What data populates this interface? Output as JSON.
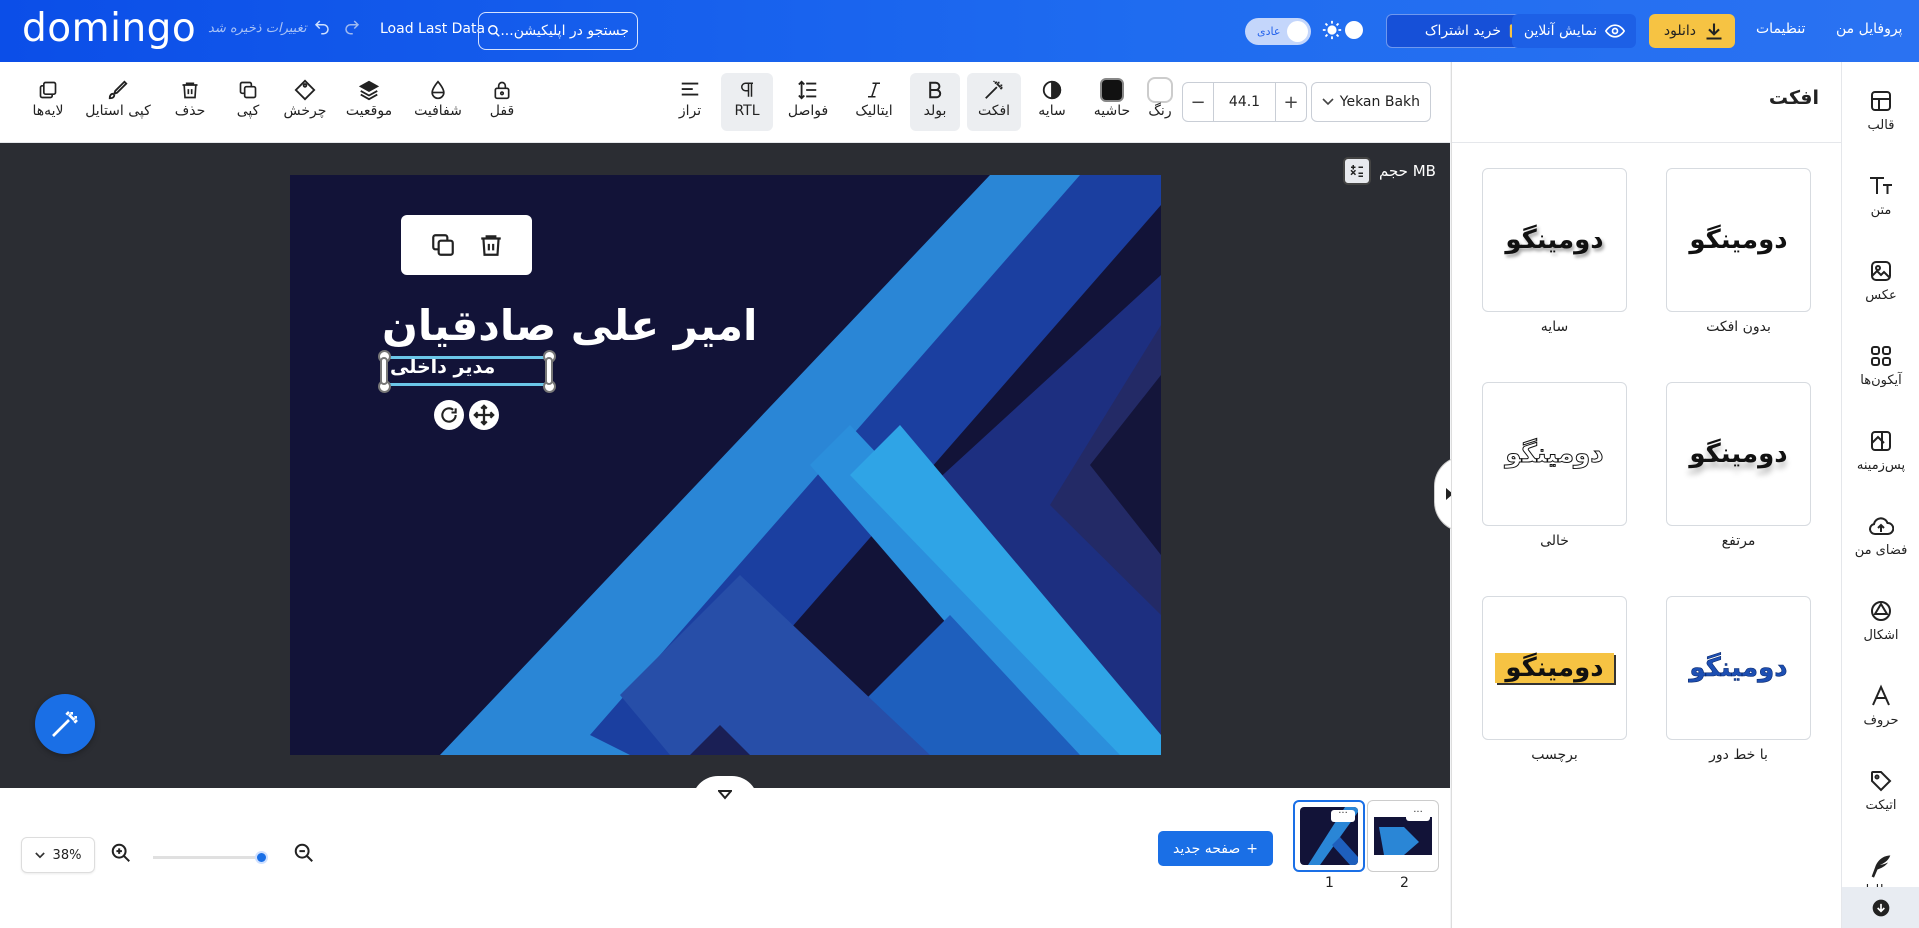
{
  "topbar": {
    "logo": "domingo",
    "saved_status": "تغییرات ذخیره شد",
    "load_last": "Load Last Data",
    "search_placeholder": "جستجو در اپلیکیشن...",
    "theme_label": "عادی",
    "subscribe": "خرید اشتراک",
    "online_preview": "نمایش آنلاین",
    "download": "دانلود",
    "settings": "تنظیمات",
    "profile": "پروفایل من"
  },
  "toolbar": {
    "layers": "لایه‌ها",
    "copy_style": "کپی استایل",
    "delete": "حذف",
    "copy": "کپی",
    "rotate": "چرخش",
    "position": "موقعیت",
    "opacity": "شفافیت",
    "lock": "قفل",
    "align": "تراز",
    "rtl": "RTL",
    "spacing": "فواصل",
    "italic": "ایتالیک",
    "bold": "بولد",
    "effect": "افکت",
    "shadow": "سایه",
    "border": "حاشیه",
    "color": "رنگ",
    "font_size": "44.1",
    "font_family": "Yekan Bakh"
  },
  "canvas": {
    "size_label": "حجم MB",
    "title": "امیر علی صادقیان",
    "subtitle": "مدیر داخلی",
    "background_color": "#121338"
  },
  "bottom": {
    "zoom": "38%",
    "new_page": "صفحه جدید",
    "pages": [
      "1",
      "2"
    ]
  },
  "panel": {
    "title": "افکت",
    "sample_text": "دومینگو",
    "effects": [
      {
        "label": "بدون افکت",
        "style": "none"
      },
      {
        "label": "سایه",
        "style": "shadow"
      },
      {
        "label": "مرتفع",
        "style": "lift"
      },
      {
        "label": "خالی",
        "style": "hollow"
      },
      {
        "label": "با خط دور",
        "style": "outline"
      },
      {
        "label": "برچسب",
        "style": "label"
      }
    ]
  },
  "nav": {
    "items": [
      "قالب",
      "متن",
      "عکس",
      "آیکون‌ها",
      "پس‌زمینه",
      "فضای من",
      "اشکال",
      "حروف",
      "اتیکت",
      "خطاط"
    ]
  },
  "colors": {
    "brand": "#1a6fe6",
    "download": "#f6c343",
    "accent_selection": "#6bc6e8"
  }
}
